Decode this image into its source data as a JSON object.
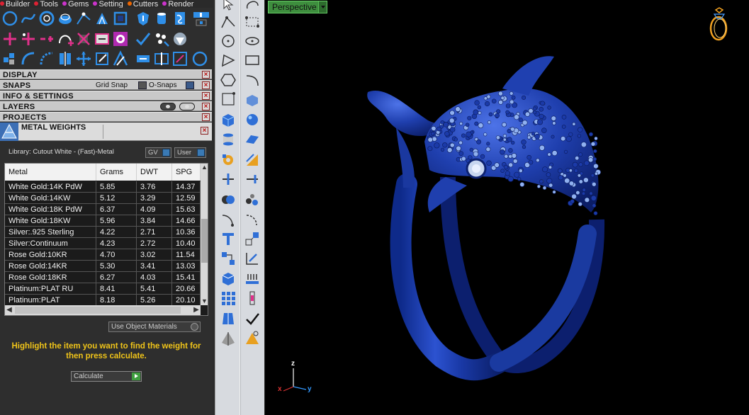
{
  "menubar": {
    "items": [
      {
        "label": "Builder",
        "dot": "#d23"
      },
      {
        "label": "Tools",
        "dot": "#d23"
      },
      {
        "label": "Gems",
        "dot": "#c3c"
      },
      {
        "label": "Setting",
        "dot": "#c3c"
      },
      {
        "label": "Cutters",
        "dot": "#e60"
      },
      {
        "label": "Render",
        "dot": "#c3c"
      }
    ]
  },
  "sections": {
    "display": "DISPLAY",
    "snaps": "SNAPS",
    "grid_snap": "Grid Snap",
    "o_snaps": "O-Snaps",
    "info": "INFO & SETTINGS",
    "layers": "LAYERS",
    "projects": "PROJECTS",
    "close_glyph": "×"
  },
  "metal_weights": {
    "title": "METAL WEIGHTS",
    "library": "Library: Cutout White - (Fast)-Metal",
    "gv_label": "GV",
    "user_label": "User",
    "columns": [
      "Metal",
      "Grams",
      "DWT",
      "SPG"
    ],
    "rows": [
      [
        "White Gold:14K PdW",
        "5.85",
        "3.76",
        "14.37"
      ],
      [
        "White Gold:14KW",
        "5.12",
        "3.29",
        "12.59"
      ],
      [
        "White Gold:18K PdW",
        "6.37",
        "4.09",
        "15.63"
      ],
      [
        "White Gold:18KW",
        "5.96",
        "3.84",
        "14.66"
      ],
      [
        "Silver:.925 Sterling",
        "4.22",
        "2.71",
        "10.36"
      ],
      [
        "Silver:Continuum",
        "4.23",
        "2.72",
        "10.40"
      ],
      [
        "Rose Gold:10KR",
        "4.70",
        "3.02",
        "11.54"
      ],
      [
        "Rose Gold:14KR",
        "5.30",
        "3.41",
        "13.03"
      ],
      [
        "Rose Gold:18KR",
        "6.27",
        "4.03",
        "15.41"
      ],
      [
        "Platinum:PLAT RU",
        "8.41",
        "5.41",
        "20.66"
      ],
      [
        "Platinum:PLAT",
        "8.18",
        "5.26",
        "20.10"
      ]
    ],
    "use_object_materials": "Use Object Materials",
    "instruction": "Highlight the item you want to find the weight for then press calculate.",
    "calculate_label": "Calculate"
  },
  "viewport": {
    "view_name": "Perspective",
    "axis": {
      "z": "z",
      "x": "x",
      "y": "y"
    },
    "colors": {
      "ring": "#1f3fae",
      "background": "#000000",
      "view_tab": "#3e8e3e"
    }
  },
  "icons": {
    "toolbar_rows": [
      "circle-icon",
      "curve-icon",
      "ring-circle-icon",
      "gem-shape-icon",
      "node-edit-icon",
      "prong-icon",
      "cylinder-icon",
      "scroll-icon",
      "layer-toggle-icon"
    ],
    "vertical_toolbar": [
      "select-arrow-icon",
      "polyline-icon",
      "circle-tool-icon",
      "polygon-icon",
      "hexagon-icon",
      "box-icon",
      "cylinder-tool-icon",
      "transform-icon",
      "split-icon",
      "boolean-icon",
      "curve-tool-icon",
      "text-tool-icon",
      "grid-icon",
      "array-icon",
      "cut-icon",
      "checkmark-icon"
    ]
  }
}
